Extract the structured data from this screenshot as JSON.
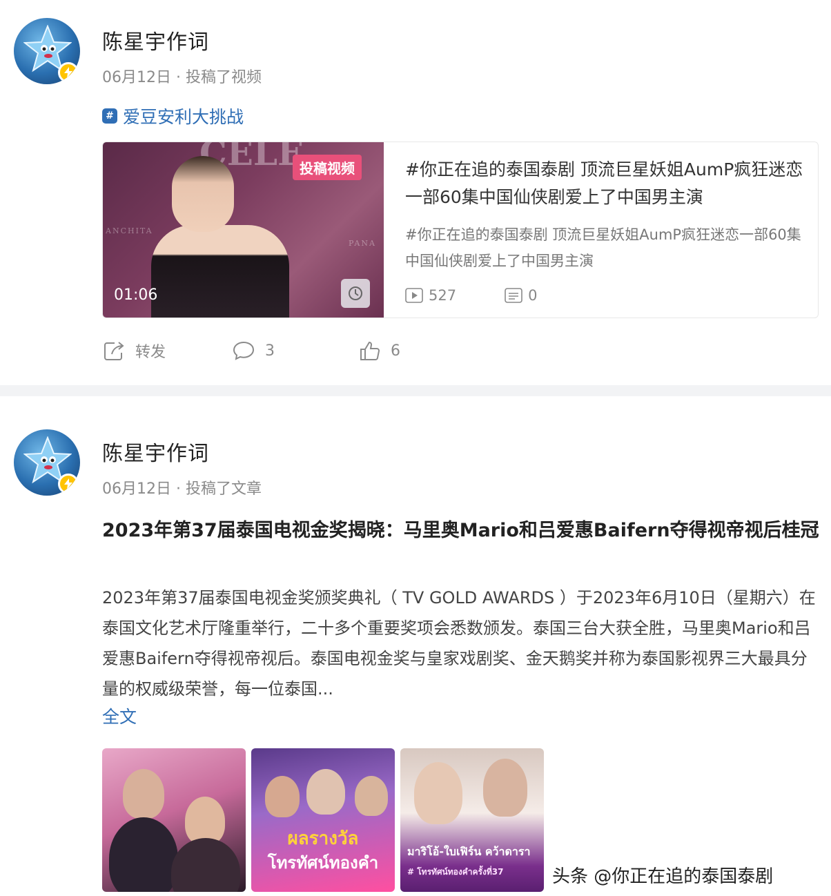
{
  "post1": {
    "username": "陈星宇作词",
    "meta": "06月12日 · 投稿了视频",
    "topic": "爱豆安利大挑战",
    "video": {
      "tag": "投稿视频",
      "duration": "01:06",
      "title": "#你正在追的泰国泰剧 顶流巨星妖姐AumP疯狂迷恋一部60集中国仙侠剧爱上了中国男主演",
      "description": "#你正在追的泰国泰剧 顶流巨星妖姐AumP疯狂迷恋一部60集中国仙侠剧爱上了中国男主演",
      "plays": "527",
      "comments": "0",
      "thumb_text_top": "CELE",
      "thumb_text_left": "ANCHITA",
      "thumb_text_right": "PANA"
    },
    "actions": {
      "repost": "转发",
      "comment_count": "3",
      "like_count": "6"
    }
  },
  "post2": {
    "username": "陈星宇作词",
    "meta": "06月12日 · 投稿了文章",
    "title": "2023年第37届泰国电视金奖揭晓：马里奥Mario和吕爱惠Baifern夺得视帝视后桂冠",
    "body": "2023年第37届泰国电视金奖颁奖典礼（ TV GOLD AWARDS ）于2023年6月10日（星期六）在泰国文化艺术厅隆重举行，二十多个重要奖项会悉数颁发。泰国三台大获全胜，马里奥Mario和吕爱惠Baifern夺得视帝视后。泰国电视金奖与皇家戏剧奖、金天鹅奖并称为泰国影视界三大最具分量的权威级荣誉，每一位泰国...",
    "fulltext": "全文",
    "images": [
      {
        "overlay1": "",
        "overlay2": ""
      },
      {
        "overlay1": "ผลรางวัล",
        "overlay2": "โทรทัศน์ทองคำ"
      },
      {
        "overlay1": "มาริโอ้-ใบเฟิร์น คว้าดารา",
        "overlay2": "# โทรทัศน์ทองคำครั้งที่37"
      }
    ]
  },
  "watermark": "头条 @你正在追的泰国泰剧",
  "colors": {
    "link": "#2f6eb5",
    "badge": "#ffc400",
    "tag": "#e8507a",
    "divider": "#f2f3f5"
  }
}
